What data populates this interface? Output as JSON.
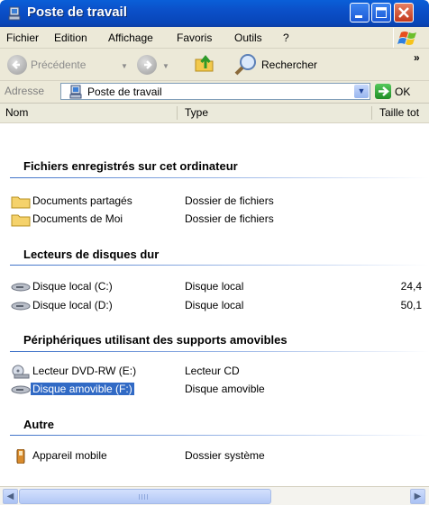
{
  "window": {
    "title": "Poste de travail"
  },
  "menu": {
    "items": [
      "Fichier",
      "Edition",
      "Affichage",
      "Favoris",
      "Outils",
      "?"
    ],
    "more": "»"
  },
  "toolbar": {
    "back_label": "Précédente",
    "search_label": "Rechercher"
  },
  "address": {
    "label": "Adresse",
    "value": "Poste de travail",
    "go_label": "OK"
  },
  "columns": {
    "name": "Nom",
    "type": "Type",
    "size": "Taille tot"
  },
  "groups": [
    {
      "title": "Fichiers enregistrés sur cet ordinateur",
      "items": [
        {
          "name": "Documents partagés",
          "type": "Dossier de fichiers",
          "size": "",
          "icon": "folder-icon"
        },
        {
          "name": "Documents de Moi",
          "type": "Dossier de fichiers",
          "size": "",
          "icon": "folder-icon"
        }
      ]
    },
    {
      "title": "Lecteurs de disques dur",
      "items": [
        {
          "name": "Disque local (C:)",
          "type": "Disque local",
          "size": "24,4",
          "icon": "hard-disk-icon"
        },
        {
          "name": "Disque local (D:)",
          "type": "Disque local",
          "size": "50,1",
          "icon": "hard-disk-icon"
        }
      ]
    },
    {
      "title": "Périphériques utilisant des supports amovibles",
      "items": [
        {
          "name": "Lecteur DVD-RW (E:)",
          "type": "Lecteur CD",
          "size": "",
          "icon": "dvd-drive-icon"
        },
        {
          "name": "Disque amovible (F:)",
          "type": "Disque amovible",
          "size": "",
          "icon": "removable-disk-icon",
          "selected": true
        }
      ]
    },
    {
      "title": "Autre",
      "items": [
        {
          "name": "Appareil mobile",
          "type": "Dossier système",
          "size": "",
          "icon": "mobile-device-icon"
        }
      ]
    }
  ],
  "colors": {
    "titlebar": "#0b4fc8",
    "selection": "#316ac5",
    "chrome": "#ece9d8"
  }
}
